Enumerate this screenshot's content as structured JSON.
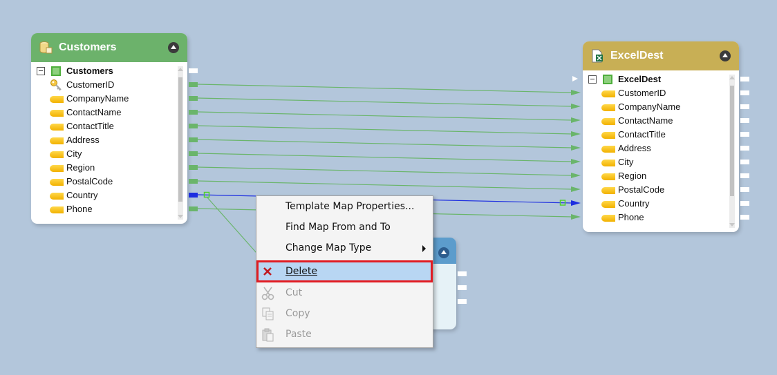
{
  "source": {
    "title": "Customers",
    "root": "Customers",
    "fields": [
      "CustomerID",
      "CompanyName",
      "ContactName",
      "ContactTitle",
      "Address",
      "City",
      "Region",
      "PostalCode",
      "Country",
      "Phone"
    ],
    "header_color": "#6cb26b"
  },
  "target": {
    "title": "ExcelDest",
    "root": "ExcelDest",
    "fields": [
      "CustomerID",
      "CompanyName",
      "ContactName",
      "ContactTitle",
      "Address",
      "City",
      "Region",
      "PostalCode",
      "Country",
      "Phone"
    ],
    "header_color": "#c8af55"
  },
  "context_menu": {
    "items": [
      {
        "label": "Template Map Properties...",
        "icon": "",
        "disabled": false,
        "submenu": false
      },
      {
        "label": "Find Map From and To",
        "icon": "",
        "disabled": false,
        "submenu": false
      },
      {
        "label": "Change Map Type",
        "icon": "",
        "disabled": false,
        "submenu": true
      },
      {
        "label": "Delete",
        "icon": "delete-x-icon",
        "disabled": false,
        "submenu": false,
        "highlighted": true
      },
      {
        "label": "Cut",
        "icon": "scissors-icon",
        "disabled": true,
        "submenu": false
      },
      {
        "label": "Copy",
        "icon": "copy-icon",
        "disabled": true,
        "submenu": false
      },
      {
        "label": "Paste",
        "icon": "paste-icon",
        "disabled": true,
        "submenu": false
      }
    ]
  },
  "colors": {
    "canvas": "#b3c6db",
    "link": "#6ab56b",
    "selected_link": "#1d2ee0",
    "highlight_border": "#e11b22"
  }
}
